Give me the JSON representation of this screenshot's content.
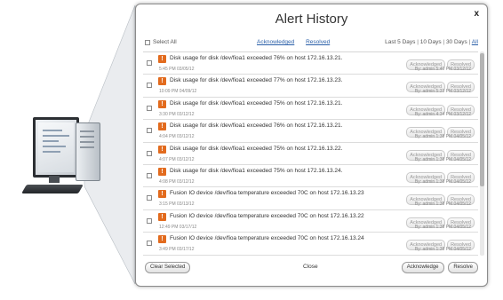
{
  "dialog": {
    "title": "Alert History",
    "close_glyph": "x"
  },
  "toolbar": {
    "select_all": "Select All",
    "filter_acknowledged": "Acknowledged",
    "filter_resolved": "Resolved",
    "range_prefix": "Last 5 Days",
    "range_10": "10 Days",
    "range_30": "30 Days",
    "range_all": "All"
  },
  "alerts": [
    {
      "message": "Disk usage for disk /dev/fioa1 exceeded 76% on host 172.16.13.21.",
      "time": "5:45 PM 03/05/12",
      "ack": "Acknowledged",
      "res": "Resolved",
      "by": "By: admin 5:40 PM 03/12/12"
    },
    {
      "message": "Disk usage for disk /dev/fioa1 exceeded 77% on host 172.16.13.23.",
      "time": "10:09 PM 04/09/12",
      "ack": "Acknowledged",
      "res": "Resolved",
      "by": "By: admin 5:33 PM 03/12/12"
    },
    {
      "message": "Disk usage for disk /dev/fioa1 exceeded 75% on host 172.16.13.21.",
      "time": "3:30 PM 03/12/12",
      "ack": "Acknowledged",
      "res": "Resolved",
      "by": "By: admin 4:34 PM 03/12/12"
    },
    {
      "message": "Disk usage for disk /dev/fioa1 exceeded 76% on host 172.16.13.21.",
      "time": "4:04 PM 03/12/12",
      "ack": "Acknowledged",
      "res": "Resolved",
      "by": "By: admin 1:38 PM 04/05/12"
    },
    {
      "message": "Disk usage for disk /dev/fioa1 exceeded 75% on host 172.16.13.22.",
      "time": "4:07 PM 03/12/12",
      "ack": "Acknowledged",
      "res": "Resolved",
      "by": "By: admin 1:38 PM 04/05/12"
    },
    {
      "message": "Disk usage for disk /dev/fioa1 exceeded 75% on host 172.16.13.24.",
      "time": "4:08 PM 03/12/12",
      "ack": "Acknowledged",
      "res": "Resolved",
      "by": "By: admin 1:38 PM 04/05/12"
    },
    {
      "message": "Fusion IO device /dev/fioa temperature exceeded 70C on host 172.16.13.23",
      "time": "3:15 PM 03/13/12",
      "ack": "Acknowledged",
      "res": "Resolved",
      "by": "By: admin 1:38 PM 04/05/12"
    },
    {
      "message": "Fusion IO device /dev/fioa temperature exceeded 70C on host 172.16.13.22",
      "time": "12:49 PM 03/17/12",
      "ack": "Acknowledged",
      "res": "Resolved",
      "by": "By: admin 1:38 PM 04/05/12"
    },
    {
      "message": "Fusion IO device /dev/fioa temperature exceeded 70C on host 172.16.13.24",
      "time": "3:49 PM 03/17/12",
      "ack": "Acknowledged",
      "res": "Resolved",
      "by": "By: admin 1:38 PM 04/05/12"
    }
  ],
  "footer": {
    "clear_selected": "Clear Selected",
    "close": "Close",
    "acknowledge": "Acknowledge",
    "resolve": "Resolve"
  },
  "icons": {
    "alert_icon": "warning-icon",
    "alert_glyph": "!"
  },
  "colors": {
    "alert_orange": "#e26b1e",
    "link_blue": "#2a5fa8"
  }
}
